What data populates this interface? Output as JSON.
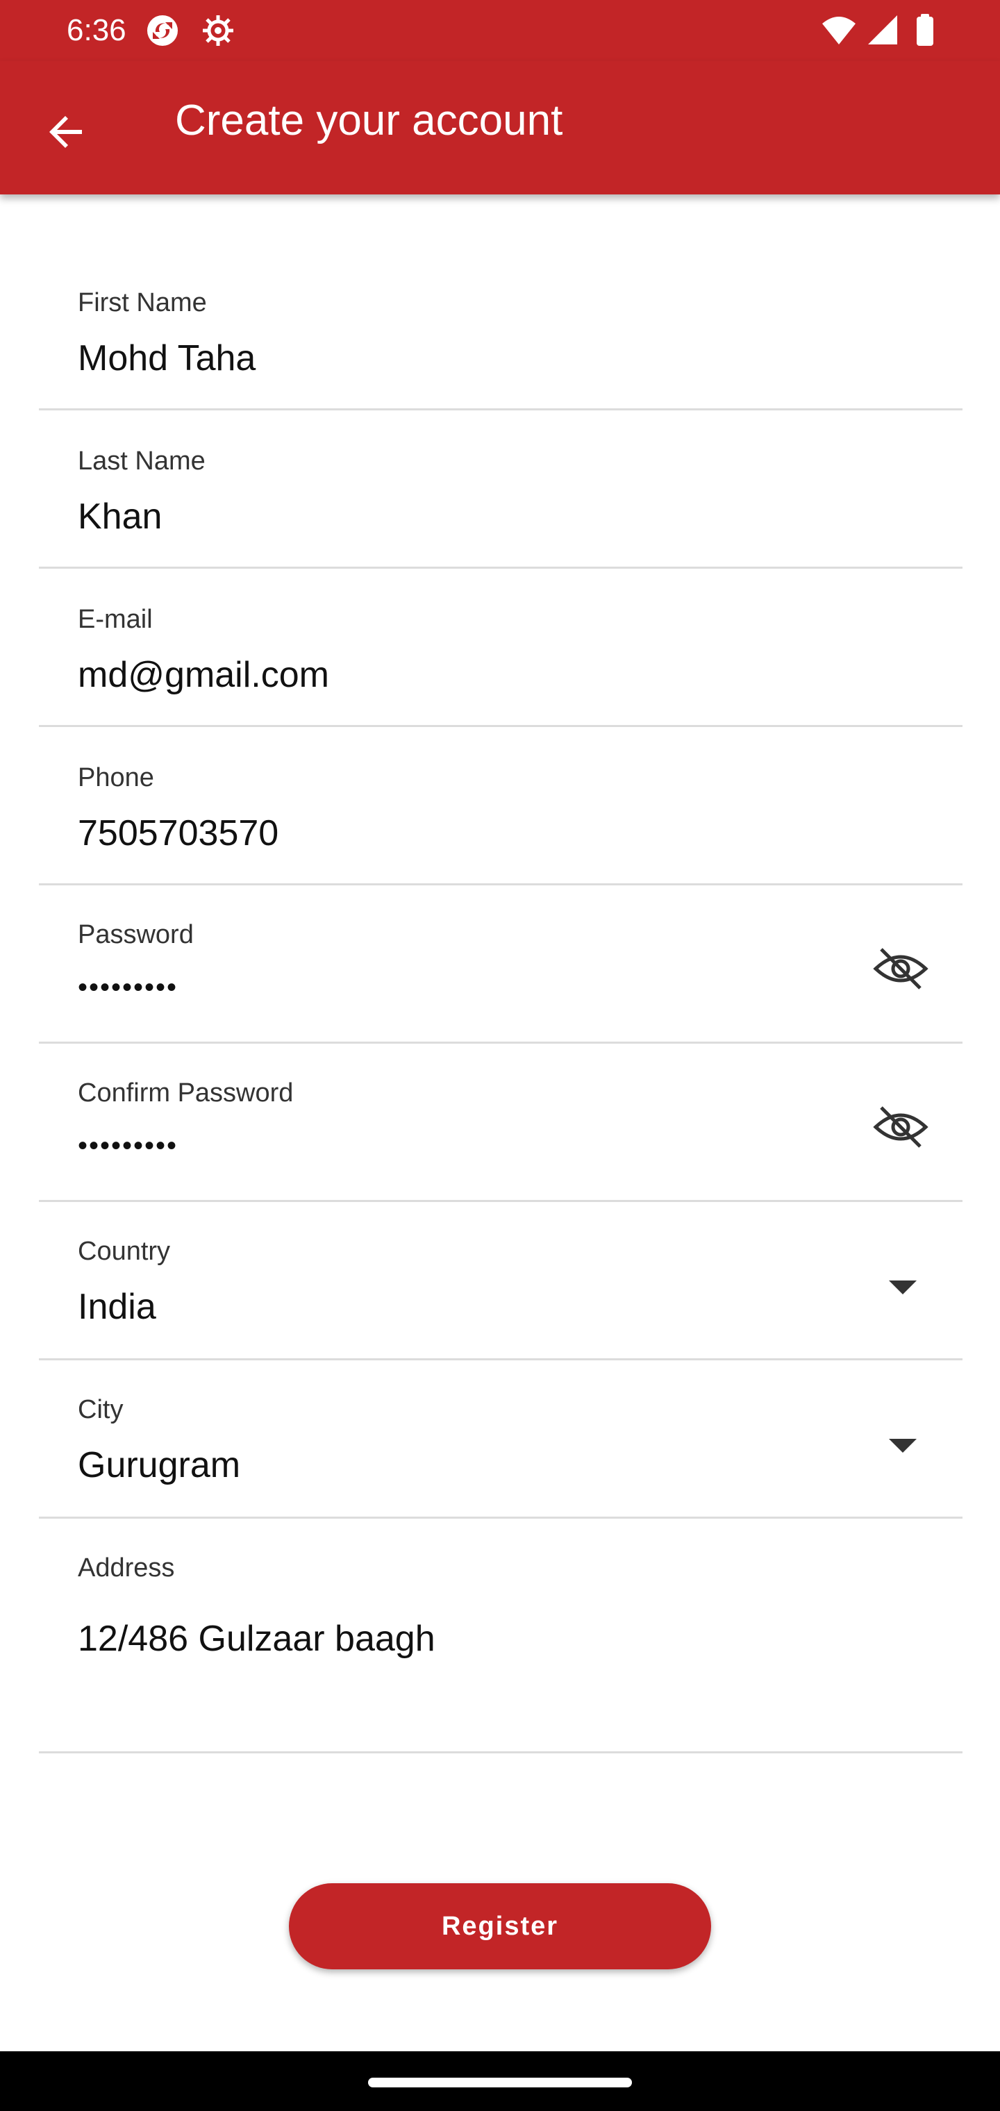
{
  "status_bar": {
    "time": "6:36",
    "icons": [
      "sync-notification-icon",
      "settings-notification-icon",
      "wifi-icon",
      "signal-icon",
      "battery-icon"
    ]
  },
  "app_bar": {
    "title": "Create your account",
    "back_icon": "arrow-back-icon"
  },
  "form": {
    "first_name": {
      "label": "First Name",
      "value": "Mohd Taha"
    },
    "last_name": {
      "label": "Last Name",
      "value": "Khan"
    },
    "email": {
      "label": "E-mail",
      "value": "md@gmail.com"
    },
    "phone": {
      "label": "Phone",
      "value": "7505703570"
    },
    "password": {
      "label": "Password",
      "value": "•••••••••",
      "toggle_icon": "visibility-off-icon"
    },
    "confirm_password": {
      "label": "Confirm Password",
      "value": "•••••••••",
      "toggle_icon": "visibility-off-icon"
    },
    "country": {
      "label": "Country",
      "value": "India",
      "dropdown_icon": "arrow-drop-down-icon"
    },
    "city": {
      "label": "City",
      "value": "Gurugram",
      "dropdown_icon": "arrow-drop-down-icon"
    },
    "address": {
      "label": "Address",
      "value": "12/486 Gulzaar baagh"
    }
  },
  "register_button": {
    "label": "Register"
  },
  "colors": {
    "primary": "#c22527",
    "divider": "#dcdcdc",
    "text": "#111111"
  }
}
